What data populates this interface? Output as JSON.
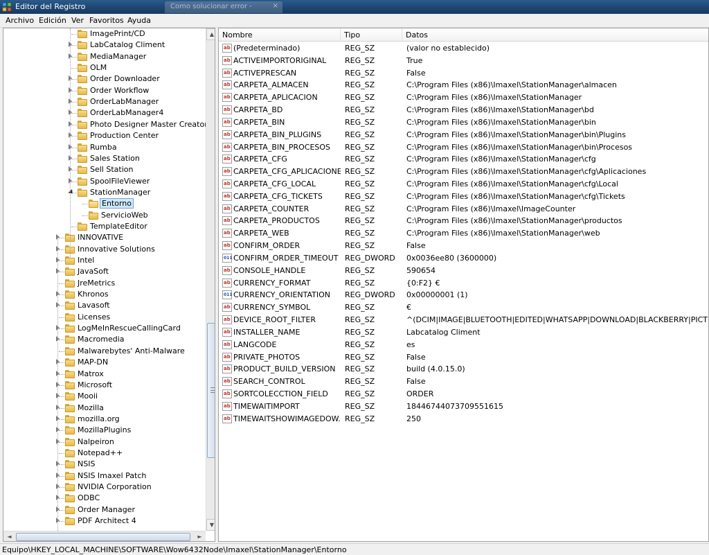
{
  "window": {
    "title": "Editor del Registro",
    "ghost_tab": "Como solucionar error -",
    "ghost_tab_close": "×"
  },
  "menu": [
    "Archivo",
    "Edición",
    "Ver",
    "Favoritos",
    "Ayuda"
  ],
  "tree": {
    "rows": [
      {
        "label": "ImagePrint/CD",
        "level": 1,
        "expander": "none"
      },
      {
        "label": "LabCatalog Climent",
        "level": 1,
        "expander": "collapsed"
      },
      {
        "label": "MediaManager",
        "level": 1,
        "expander": "collapsed"
      },
      {
        "label": "OLM",
        "level": 1,
        "expander": "none"
      },
      {
        "label": "Order Downloader",
        "level": 1,
        "expander": "collapsed"
      },
      {
        "label": "Order Workflow",
        "level": 1,
        "expander": "collapsed"
      },
      {
        "label": "OrderLabManager",
        "level": 1,
        "expander": "collapsed"
      },
      {
        "label": "OrderLabManager4",
        "level": 1,
        "expander": "collapsed"
      },
      {
        "label": "Photo Designer Master Creator Im",
        "level": 1,
        "expander": "collapsed"
      },
      {
        "label": "Production Center",
        "level": 1,
        "expander": "collapsed"
      },
      {
        "label": "Rumba",
        "level": 1,
        "expander": "collapsed"
      },
      {
        "label": "Sales Station",
        "level": 1,
        "expander": "collapsed"
      },
      {
        "label": "Sell Station",
        "level": 1,
        "expander": "collapsed"
      },
      {
        "label": "SpoolFileViewer",
        "level": 1,
        "expander": "collapsed"
      },
      {
        "label": "StationManager",
        "level": 1,
        "expander": "expanded"
      },
      {
        "label": "Entorno",
        "level": 2,
        "expander": "none",
        "selected": true
      },
      {
        "label": "ServicioWeb",
        "level": 2,
        "expander": "none"
      },
      {
        "label": "TemplateEditor",
        "level": 1,
        "expander": "none"
      },
      {
        "label": "INNOVATIVE",
        "level": 0,
        "expander": "collapsed"
      },
      {
        "label": "Innovative Solutions",
        "level": 0,
        "expander": "collapsed"
      },
      {
        "label": "Intel",
        "level": 0,
        "expander": "collapsed"
      },
      {
        "label": "JavaSoft",
        "level": 0,
        "expander": "collapsed"
      },
      {
        "label": "JreMetrics",
        "level": 0,
        "expander": "none"
      },
      {
        "label": "Khronos",
        "level": 0,
        "expander": "collapsed"
      },
      {
        "label": "Lavasoft",
        "level": 0,
        "expander": "collapsed"
      },
      {
        "label": "Licenses",
        "level": 0,
        "expander": "none"
      },
      {
        "label": "LogMeInRescueCallingCard",
        "level": 0,
        "expander": "collapsed"
      },
      {
        "label": "Macromedia",
        "level": 0,
        "expander": "collapsed"
      },
      {
        "label": "Malwarebytes' Anti-Malware",
        "level": 0,
        "expander": "none"
      },
      {
        "label": "MAP-DN",
        "level": 0,
        "expander": "collapsed"
      },
      {
        "label": "Matrox",
        "level": 0,
        "expander": "collapsed"
      },
      {
        "label": "Microsoft",
        "level": 0,
        "expander": "collapsed"
      },
      {
        "label": "Mooii",
        "level": 0,
        "expander": "collapsed"
      },
      {
        "label": "Mozilla",
        "level": 0,
        "expander": "collapsed"
      },
      {
        "label": "mozilla.org",
        "level": 0,
        "expander": "collapsed"
      },
      {
        "label": "MozillaPlugins",
        "level": 0,
        "expander": "collapsed"
      },
      {
        "label": "Nalpeiron",
        "level": 0,
        "expander": "collapsed"
      },
      {
        "label": "Notepad++",
        "level": 0,
        "expander": "none"
      },
      {
        "label": "NSIS",
        "level": 0,
        "expander": "collapsed"
      },
      {
        "label": "NSIS Imaxel Patch",
        "level": 0,
        "expander": "collapsed"
      },
      {
        "label": "NVIDIA Corporation",
        "level": 0,
        "expander": "collapsed"
      },
      {
        "label": "ODBC",
        "level": 0,
        "expander": "collapsed"
      },
      {
        "label": "Order Manager",
        "level": 0,
        "expander": "collapsed"
      },
      {
        "label": "PDF Architect 4",
        "level": 0,
        "expander": "collapsed"
      }
    ],
    "scroll_up": "▲",
    "scroll_down": "▼",
    "scroll_left": "◄",
    "scroll_right": "►"
  },
  "list": {
    "columns": {
      "name": "Nombre",
      "type": "Tipo",
      "data": "Datos"
    },
    "rows": [
      {
        "name": "(Predeterminado)",
        "type": "REG_SZ",
        "data": "(valor no establecido)"
      },
      {
        "name": "ACTIVEIMPORTORIGINAL",
        "type": "REG_SZ",
        "data": "True"
      },
      {
        "name": "ACTIVEPRESCAN",
        "type": "REG_SZ",
        "data": "False"
      },
      {
        "name": "CARPETA_ALMACEN",
        "type": "REG_SZ",
        "data": "C:\\Program Files (x86)\\Imaxel\\StationManager\\almacen"
      },
      {
        "name": "CARPETA_APLICACION",
        "type": "REG_SZ",
        "data": "C:\\Program Files (x86)\\Imaxel\\StationManager"
      },
      {
        "name": "CARPETA_BD",
        "type": "REG_SZ",
        "data": "C:\\Program Files (x86)\\Imaxel\\StationManager\\bd"
      },
      {
        "name": "CARPETA_BIN",
        "type": "REG_SZ",
        "data": "C:\\Program Files (x86)\\Imaxel\\StationManager\\bin"
      },
      {
        "name": "CARPETA_BIN_PLUGINS",
        "type": "REG_SZ",
        "data": "C:\\Program Files (x86)\\Imaxel\\StationManager\\bin\\Plugins"
      },
      {
        "name": "CARPETA_BIN_PROCESOS",
        "type": "REG_SZ",
        "data": "C:\\Program Files (x86)\\Imaxel\\StationManager\\bin\\Procesos"
      },
      {
        "name": "CARPETA_CFG",
        "type": "REG_SZ",
        "data": "C:\\Program Files (x86)\\Imaxel\\StationManager\\cfg"
      },
      {
        "name": "CARPETA_CFG_APLICACIONES",
        "type": "REG_SZ",
        "data": "C:\\Program Files (x86)\\Imaxel\\StationManager\\cfg\\Aplicaciones"
      },
      {
        "name": "CARPETA_CFG_LOCAL",
        "type": "REG_SZ",
        "data": "C:\\Program Files (x86)\\Imaxel\\StationManager\\cfg\\Local"
      },
      {
        "name": "CARPETA_CFG_TICKETS",
        "type": "REG_SZ",
        "data": "C:\\Program Files (x86)\\Imaxel\\StationManager\\cfg\\Tickets"
      },
      {
        "name": "CARPETA_COUNTER",
        "type": "REG_SZ",
        "data": "C:\\Program Files (x86)\\Imaxel\\ImageCounter"
      },
      {
        "name": "CARPETA_PRODUCTOS",
        "type": "REG_SZ",
        "data": "C:\\Program Files (x86)\\Imaxel\\StationManager\\productos"
      },
      {
        "name": "CARPETA_WEB",
        "type": "REG_SZ",
        "data": "C:\\Program Files (x86)\\Imaxel\\StationManager\\web"
      },
      {
        "name": "CONFIRM_ORDER",
        "type": "REG_SZ",
        "data": "False"
      },
      {
        "name": "CONFIRM_ORDER_TIMEOUT",
        "type": "REG_DWORD",
        "data": "0x0036ee80 (3600000)"
      },
      {
        "name": "CONSOLE_HANDLE",
        "type": "REG_SZ",
        "data": "590654"
      },
      {
        "name": "CURRENCY_FORMAT",
        "type": "REG_SZ",
        "data": "{0:F2} €"
      },
      {
        "name": "CURRENCY_ORIENTATION",
        "type": "REG_DWORD",
        "data": "0x00000001 (1)"
      },
      {
        "name": "CURRENCY_SYMBOL",
        "type": "REG_SZ",
        "data": "€"
      },
      {
        "name": "DEVICE_ROOT_FILTER",
        "type": "REG_SZ",
        "data": "^(DCIM|IMAGE|BLUETOOTH|EDITED|WHATSAPP|DOWNLOAD|BLACKBERRY|PICTURES)$"
      },
      {
        "name": "INSTALLER_NAME",
        "type": "REG_SZ",
        "data": "Labcatalog Climent"
      },
      {
        "name": "LANGCODE",
        "type": "REG_SZ",
        "data": "es"
      },
      {
        "name": "PRIVATE_PHOTOS",
        "type": "REG_SZ",
        "data": "False"
      },
      {
        "name": "PRODUCT_BUILD_VERSION",
        "type": "REG_SZ",
        "data": "build (4.0.15.0)"
      },
      {
        "name": "SEARCH_CONTROL",
        "type": "REG_SZ",
        "data": "False"
      },
      {
        "name": "SORTCOLECCTION_FIELD",
        "type": "REG_SZ",
        "data": "ORDER"
      },
      {
        "name": "TIMEWAITIMPORT",
        "type": "REG_SZ",
        "data": "18446744073709551615"
      },
      {
        "name": "TIMEWAITSHOWIMAGEDOW...",
        "type": "REG_SZ",
        "data": "250"
      }
    ]
  },
  "status_bar": {
    "path": "Equipo\\HKEY_LOCAL_MACHINE\\SOFTWARE\\Wow6432Node\\Imaxel\\StationManager\\Entorno"
  },
  "colors": {
    "title_bar": "#1d4470",
    "selection": "#cce8ff",
    "reg_sz_icon": "#c0302a",
    "reg_dword_icon": "#1f4fa8",
    "folder": "#e8b94a"
  },
  "icons": {
    "app": "registry-editor-icon",
    "folder": "folder-icon",
    "reg_sz": "ab-string-value-icon",
    "reg_dword": "binary-dword-value-icon"
  }
}
